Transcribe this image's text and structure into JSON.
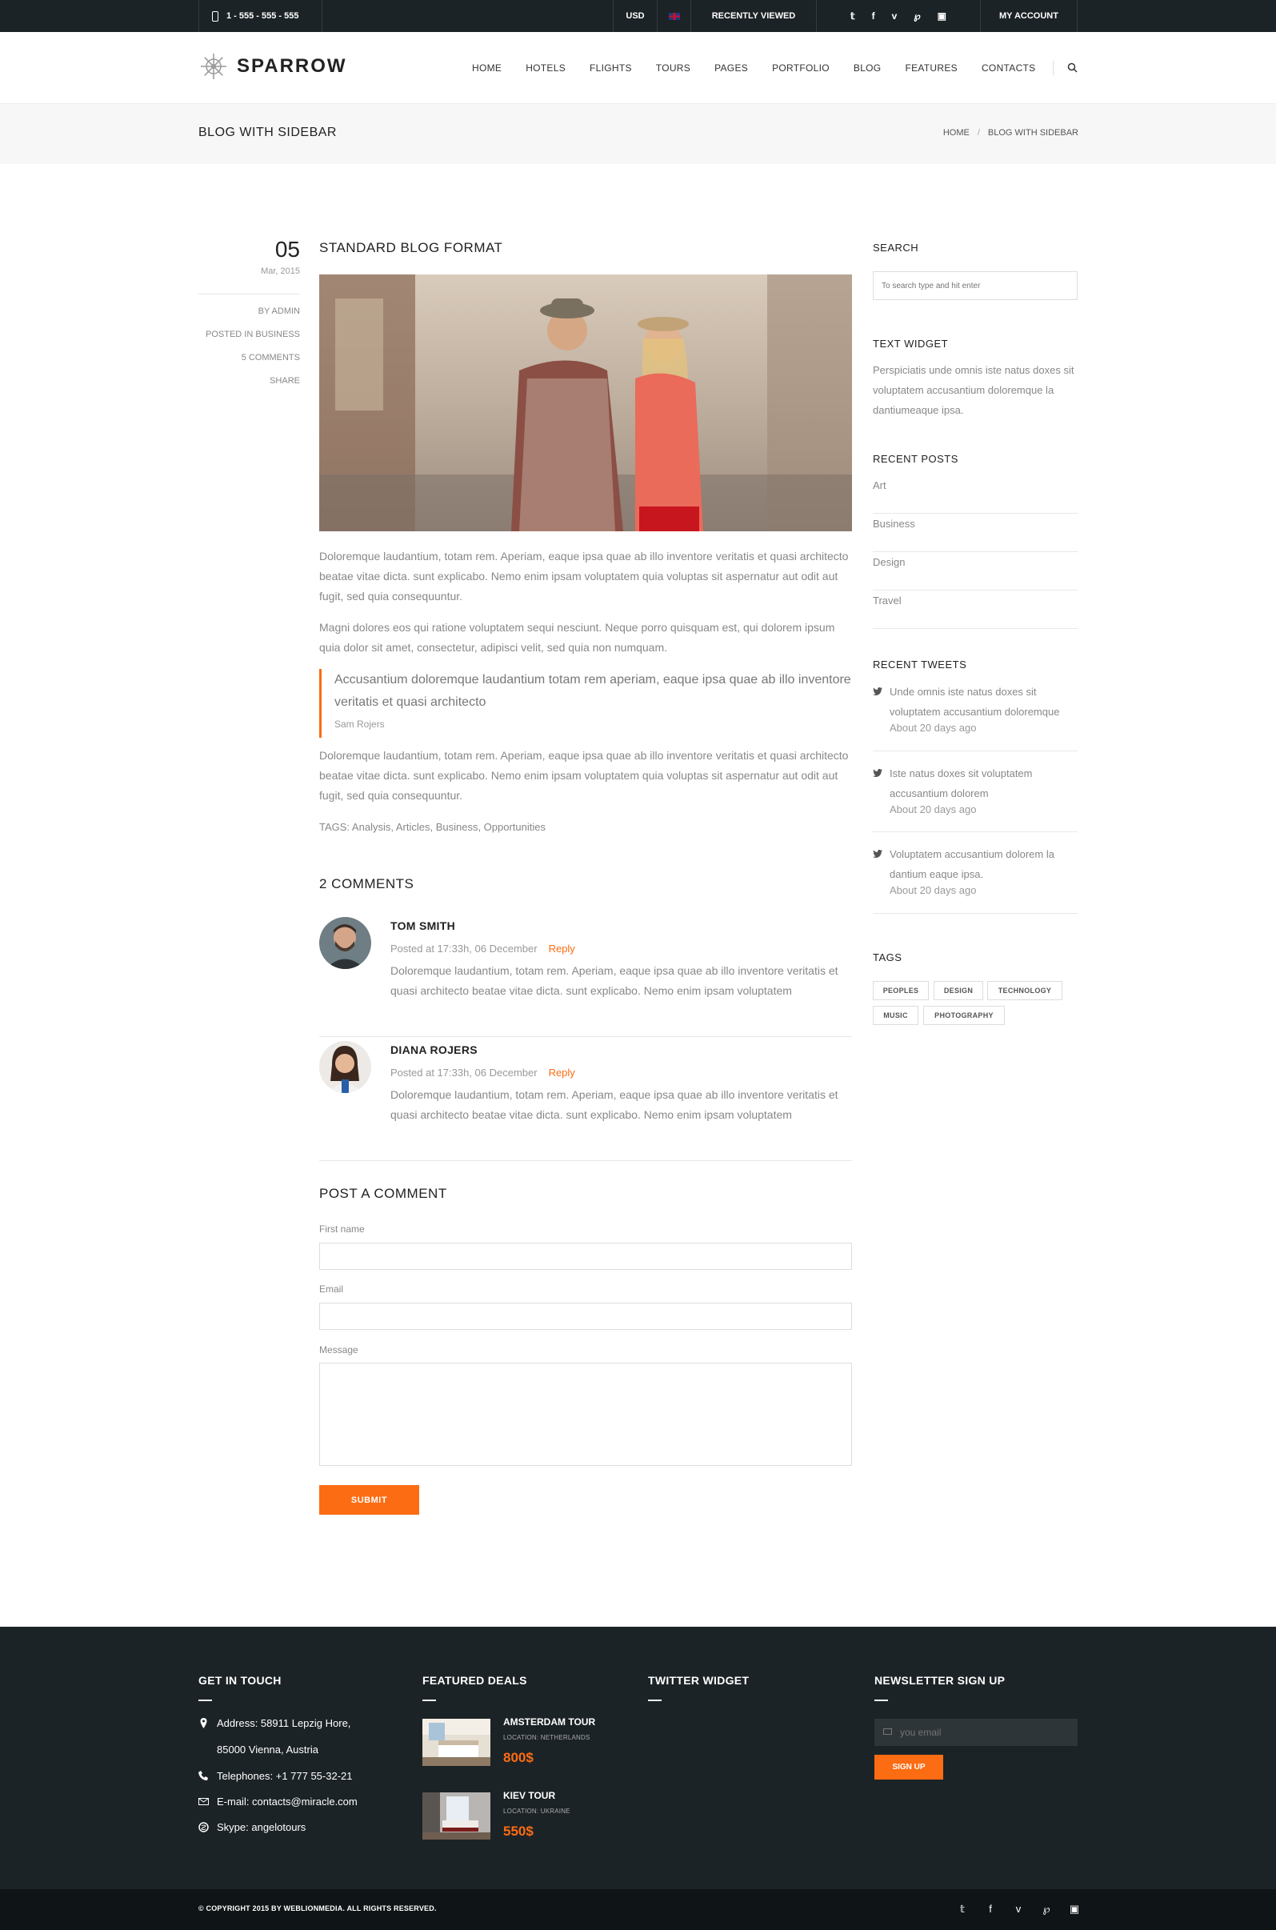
{
  "topbar": {
    "phone": "1 - 555 - 555 - 555",
    "currency": "USD",
    "recently_viewed": "RECENTLY VIEWED",
    "social": [
      "t",
      "f",
      "v",
      "p",
      "i"
    ],
    "account": "MY ACCOUNT"
  },
  "header": {
    "logo": "SPARROW",
    "nav": [
      "HOME",
      "HOTELS",
      "FLIGHTS",
      "TOURS",
      "PAGES",
      "PORTFOLIO",
      "BLOG",
      "FEATURES",
      "CONTACTS"
    ]
  },
  "titlebar": {
    "title": "BLOG WITH SIDEBAR",
    "breadcrumb_home": "HOME",
    "breadcrumb_sep": "/",
    "breadcrumb_current": "BLOG WITH SIDEBAR"
  },
  "post": {
    "day": "05",
    "month": "Mar, 2015",
    "meta": [
      "BY ADMIN",
      "POSTED IN BUSINESS",
      "5 COMMENTS",
      "SHARE"
    ],
    "title": "STANDARD BLOG FORMAT",
    "para1": "Doloremque laudantium, totam rem. Aperiam, eaque ipsa quae ab illo inventore veritatis et quasi architecto beatae vitae dicta. sunt explicabo. Nemo enim ipsam voluptatem quia voluptas sit aspernatur aut odit aut fugit, sed quia consequuntur.",
    "para2": "Magni dolores eos qui ratione voluptatem sequi nesciunt. Neque porro quisquam est, qui dolorem ipsum quia dolor sit amet, consectetur, adipisci velit, sed quia non numquam.",
    "quote": "Accusantium doloremque laudantium totam rem aperiam, eaque ipsa quae ab illo inventore veritatis et quasi architecto",
    "quote_author": "Sam Rojers",
    "para3": "Doloremque laudantium, totam rem. Aperiam, eaque ipsa quae ab illo inventore veritatis et quasi architecto beatae vitae dicta. sunt explicabo. Nemo enim ipsam voluptatem quia voluptas sit aspernatur aut odit aut fugit, sed quia consequuntur.",
    "tags": "TAGS: Analysis, Articles, Business, Opportunities"
  },
  "comments": {
    "heading": "2 COMMENTS",
    "items": [
      {
        "name": "TOM SMITH",
        "date": "Posted at 17:33h, 06 December",
        "reply": "Reply",
        "text": "Doloremque laudantium, totam rem. Aperiam, eaque ipsa quae ab illo inventore veritatis et quasi architecto beatae vitae dicta. sunt explicabo. Nemo enim ipsam voluptatem"
      },
      {
        "name": "DIANA ROJERS",
        "date": "Posted at 17:33h, 06 December",
        "reply": "Reply",
        "text": "Doloremque laudantium, totam rem. Aperiam, eaque ipsa quae ab illo inventore veritatis et quasi architecto beatae vitae dicta. sunt explicabo. Nemo enim ipsam voluptatem"
      }
    ]
  },
  "form": {
    "heading": "POST A COMMENT",
    "first_name": "First name",
    "email": "Email",
    "message": "Message",
    "submit": "SUBMIT"
  },
  "sidebar": {
    "search_title": "SEARCH",
    "search_placeholder": "To search type and hit enter",
    "text_title": "TEXT WIDGET",
    "text_body": "Perspiciatis unde omnis iste natus doxes sit voluptatem accusantium doloremque la dantiumeaque ipsa.",
    "recent_title": "RECENT POSTS",
    "recent": [
      "Art",
      "Business",
      "Design",
      "Travel"
    ],
    "tweets_title": "RECENT TWEETS",
    "tweets": [
      {
        "text": "Unde omnis iste natus doxes sit voluptatem accusantium doloremque",
        "time": "About 20 days ago"
      },
      {
        "text": "Iste natus doxes sit voluptatem accusantium dolorem",
        "time": "About 20 days ago"
      },
      {
        "text": "Voluptatem accusantium dolorem la dantium eaque ipsa.",
        "time": "About 20 days ago"
      }
    ],
    "tags_title": "TAGS",
    "tags": [
      "PEOPLES",
      "DESIGN",
      "TECHNOLOGY",
      "MUSIC",
      "PHOTOGRAPHY"
    ]
  },
  "footer": {
    "touch_title": "GET IN TOUCH",
    "address1": "Address: 58911 Lepzig Hore,",
    "address2": "85000 Vienna, Austria",
    "phone": "Telephones: +1 777 55-32-21",
    "email": "E-mail: contacts@miracle.com",
    "skype": "Skype: angelotours",
    "deals_title": "FEATURED DEALS",
    "deals": [
      {
        "name": "AMSTERDAM TOUR",
        "location": "LOCATION: NETHERLANDS",
        "price": "800$"
      },
      {
        "name": "KIEV TOUR",
        "location": "LOCATION: UKRAINE",
        "price": "550$"
      }
    ],
    "twitter_title": "TWITTER WIDGET",
    "newsletter_title": "NEWSLETTER SIGN UP",
    "newsletter_placeholder": "you email",
    "signup": "SIGN UP",
    "copyright": "© COPYRIGHT 2015 BY WEBLIONMEDIA. ALL RIGHTS RESERVED."
  },
  "colors": {
    "accent": "#fb6c13",
    "dark": "#1c2326"
  }
}
